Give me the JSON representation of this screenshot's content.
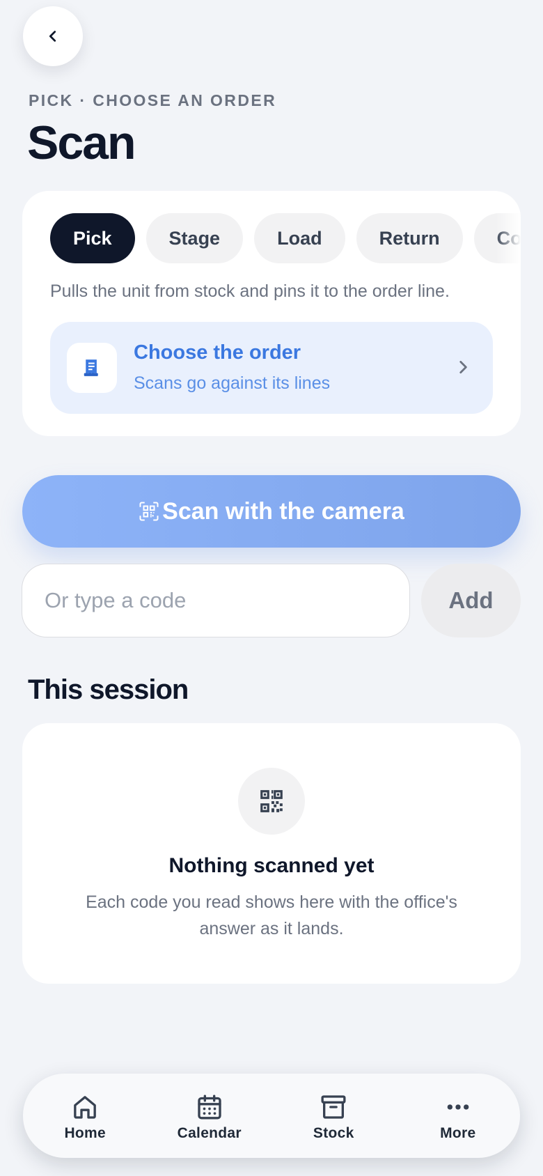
{
  "header": {
    "back_icon": "chevron-left-icon",
    "eyebrow": "PICK · CHOOSE AN ORDER",
    "title": "Scan"
  },
  "mode_card": {
    "modes": [
      {
        "label": "Pick",
        "active": true
      },
      {
        "label": "Stage",
        "active": false
      },
      {
        "label": "Load",
        "active": false
      },
      {
        "label": "Return",
        "active": false
      },
      {
        "label": "Count",
        "active": false
      }
    ],
    "description": "Pulls the unit from stock and pins it to the order line.",
    "order_picker": {
      "icon": "receipt-icon",
      "title": "Choose the order",
      "subtitle": "Scans go against its lines"
    }
  },
  "scanner": {
    "camera_label": "Scan with the camera",
    "camera_icon": "qr-scan-icon",
    "input_placeholder": "Or type a code",
    "input_value": "",
    "add_label": "Add"
  },
  "session": {
    "title": "This session",
    "empty_icon": "qr-code-icon",
    "empty_title": "Nothing scanned yet",
    "empty_desc": "Each code you read shows here with the office's answer as it lands."
  },
  "tab_bar": {
    "tabs": [
      {
        "label": "Home",
        "icon": "home-icon"
      },
      {
        "label": "Calendar",
        "icon": "calendar-icon"
      },
      {
        "label": "Stock",
        "icon": "archive-box-icon"
      },
      {
        "label": "More",
        "icon": "more-icon"
      }
    ]
  },
  "colors": {
    "background": "#f2f4f8",
    "primary_dark": "#0f172a",
    "accent_blue": "#3b78e0",
    "camera_button": "#8db3f8"
  }
}
